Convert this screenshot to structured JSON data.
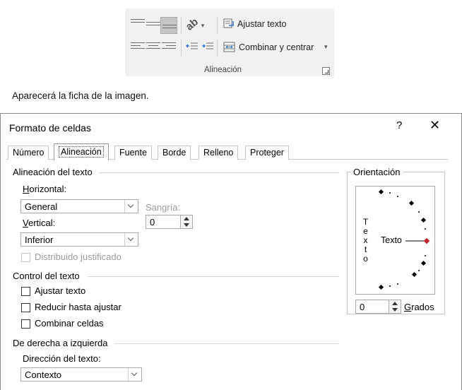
{
  "ribbon": {
    "wrap_text": "Ajustar texto",
    "merge_center": "Combinar y centrar",
    "merge_dropdown": "▾",
    "orientation_dropdown": "▾",
    "group_label": "Alineación"
  },
  "caption": "Aparecerá la ficha de la imagen.",
  "dialog": {
    "title": "Formato de celdas",
    "help": "?",
    "close": "✕",
    "tabs": [
      "Número",
      "Alineación",
      "Fuente",
      "Borde",
      "Relleno",
      "Proteger"
    ],
    "alignment": {
      "section": "Alineación del texto",
      "horizontal_label": "Horizontal:",
      "horizontal_value": "General",
      "indent_label": "Sangría:",
      "indent_value": "0",
      "vertical_label": "Vertical:",
      "vertical_value": "Inferior",
      "distributed": "Distribuido justificado"
    },
    "control": {
      "section": "Control del texto",
      "wrap": "Ajustar texto",
      "shrink": "Reducir hasta ajustar",
      "merge": "Combinar celdas"
    },
    "rtl": {
      "section": "De derecha a izquierda",
      "direction_label": "Dirección del texto:",
      "direction_value": "Contexto"
    },
    "orientation": {
      "section": "Orientación",
      "vertical_text": [
        "T",
        "e",
        "x",
        "t",
        "o"
      ],
      "dial_text": "Texto",
      "degrees_value": "0",
      "degrees_label": "Grados",
      "accent_color": "#c0282d"
    }
  }
}
